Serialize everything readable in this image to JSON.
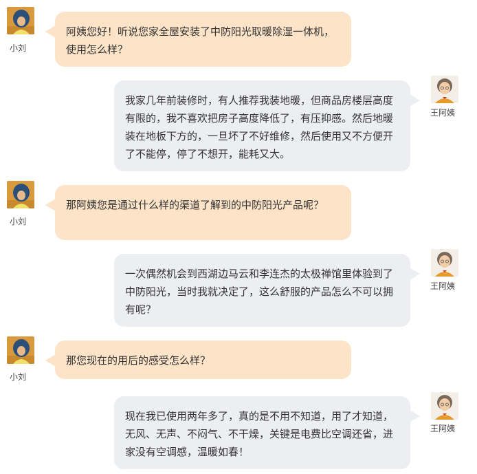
{
  "colors": {
    "left_bubble": "#fde3c8",
    "right_bubble": "#eceef1",
    "text": "#333333"
  },
  "users": {
    "left": {
      "name": "小刘",
      "icon": "avatar-girl-blue-hair"
    },
    "right": {
      "name": "王阿姨",
      "icon": "avatar-elderly-woman"
    }
  },
  "messages": [
    {
      "side": "left",
      "name": "小刘",
      "text": "阿姨您好！听说您家全屋安装了中防阳光取暖除湿一体机，使用怎么样？"
    },
    {
      "side": "right",
      "name": "王阿姨",
      "text": "我家几年前装修时，有人推荐我装地暖，但商品房楼层高度有限的，我不喜欢把房子高度降低了，有压抑感。然后地暖装在地板下方的，一旦坏了不好维修，然后使用又不方便开了不能停，停了不想开，能耗又大。"
    },
    {
      "side": "left",
      "name": "小刘",
      "text": "那阿姨您是通过什么样的渠道了解到的中防阳光产品呢？"
    },
    {
      "side": "right",
      "name": "王阿姨",
      "text": "一次偶然机会到西湖边马云和李连杰的太极禅馆里体验到了中防阳光，当时我就决定了，这么舒服的产品怎么不可以拥有呢？"
    },
    {
      "side": "left",
      "name": "小刘",
      "text": "那您现在的用后的感受怎么样？"
    },
    {
      "side": "right",
      "name": "王阿姨",
      "text": "现在我已使用两年多了，真的是不用不知道，用了才知道，无风、无声、不闷气、不干燥，关键是电费比空调还省，进家没有空调感，温暖如春！"
    }
  ]
}
